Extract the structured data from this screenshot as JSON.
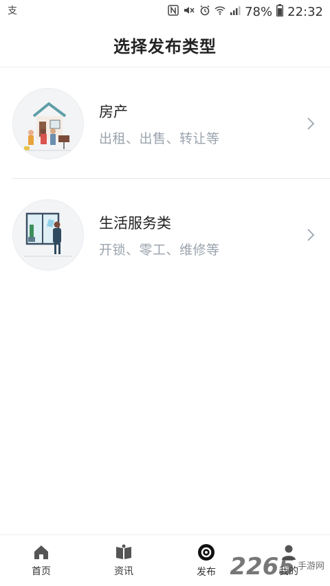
{
  "status_bar": {
    "left_icon": "alipay-icon",
    "battery": "78%",
    "time": "22:32"
  },
  "header": {
    "title": "选择发布类型"
  },
  "categories": [
    {
      "title": "房产",
      "subtitle": "出租、出售、转让等",
      "icon": "house-illustration"
    },
    {
      "title": "生活服务类",
      "subtitle": "开锁、零工、维修等",
      "icon": "service-illustration"
    }
  ],
  "tabs": [
    {
      "label": "首页",
      "icon": "home-icon"
    },
    {
      "label": "资讯",
      "icon": "book-icon"
    },
    {
      "label": "发布",
      "icon": "publish-icon"
    },
    {
      "label": "我的",
      "icon": "profile-icon"
    }
  ],
  "watermark": {
    "number": "2265",
    "text": "手游网"
  }
}
